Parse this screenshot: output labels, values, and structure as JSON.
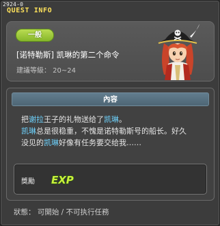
{
  "window": {
    "quest_id": "2924-0",
    "title": "QUEST INFO"
  },
  "quest": {
    "category": "一般",
    "name": "[诺特勒斯] 凯琳的第二个命令",
    "req_level": "建議等級： 20~24",
    "npc_icon": "pirate-captain-portrait-icon"
  },
  "content": {
    "header": "內容",
    "line1": [
      {
        "text": "把",
        "hl": false
      },
      {
        "text": "谢拉",
        "hl": true
      },
      {
        "text": "王子的礼物送给了",
        "hl": false
      },
      {
        "text": "凯琳",
        "hl": true
      },
      {
        "text": "。",
        "hl": false
      }
    ],
    "line2": [
      {
        "text": "凯琳",
        "hl": true
      },
      {
        "text": "总是很稳重，不愧是诺特勒斯号的船长。好久",
        "hl": false
      }
    ],
    "line3": [
      {
        "text": "没见的",
        "hl": false
      },
      {
        "text": "凯琳",
        "hl": true
      },
      {
        "text": "好像有任务要交给我……",
        "hl": false
      }
    ],
    "highlight_color": "#6fd4ff"
  },
  "reward": {
    "label": "獎勵",
    "exp_text": "EXP",
    "exp_icon": "exp-icon"
  },
  "status": "狀態： 可開始 / 不可执行任務",
  "colors": {
    "title": "#ffe25b",
    "badge": "#9cc93a",
    "content_header": "#5a7484"
  }
}
